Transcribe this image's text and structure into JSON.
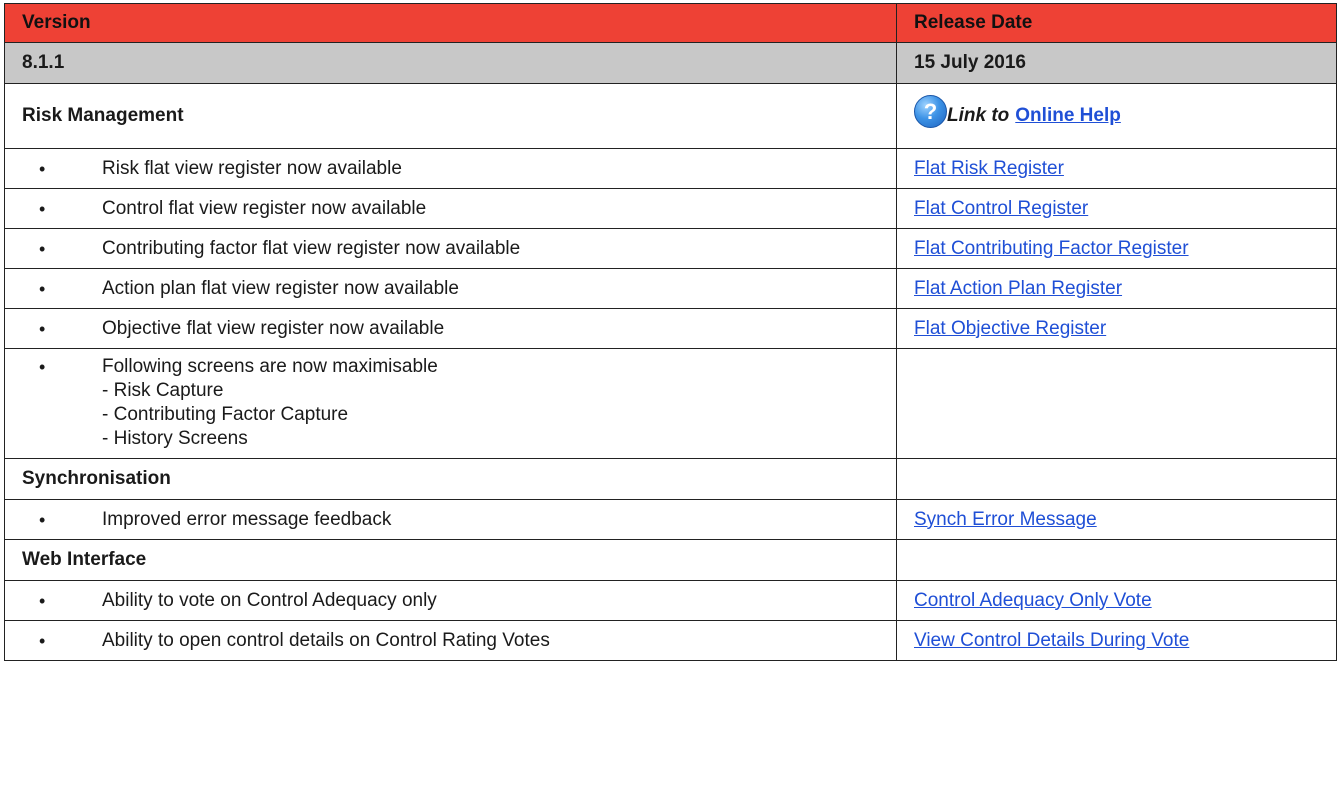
{
  "header": {
    "version_label": "Version",
    "release_date_label": "Release Date"
  },
  "version_row": {
    "version": "8.1.1",
    "release_date": "15 July 2016"
  },
  "risk_management": {
    "title": "Risk Management",
    "help_icon": "question-icon",
    "help_prefix": "Link to",
    "help_link": "Online Help",
    "items": [
      {
        "text": "Risk flat view register now available",
        "link": "Flat Risk Register"
      },
      {
        "text": "Control flat view register now available",
        "link": "Flat Control Register"
      },
      {
        "text": "Contributing factor flat view register now available",
        "link": "Flat Contributing Factor Register"
      },
      {
        "text": "Action plan flat view register now available",
        "link": "Flat Action Plan Register"
      },
      {
        "text": "Objective flat view register now available",
        "link": "Flat Objective Register"
      }
    ],
    "maximisable": {
      "text": "Following screens are now maximisable",
      "lines": [
        "- Risk Capture",
        "- Contributing Factor Capture",
        "- History Screens"
      ]
    }
  },
  "synchronisation": {
    "title": "Synchronisation",
    "items": [
      {
        "text": "Improved error message feedback",
        "link": "Synch Error Message"
      }
    ]
  },
  "web_interface": {
    "title": "Web Interface",
    "items": [
      {
        "text": "Ability to vote on Control Adequacy only",
        "link": "Control Adequacy Only Vote"
      },
      {
        "text": "Ability to open control details on Control Rating Votes",
        "link": "View Control Details During Vote"
      }
    ]
  },
  "colors": {
    "header_bg": "#ee4135",
    "version_bg": "#c8c8c8",
    "link": "#1f4fd6"
  }
}
